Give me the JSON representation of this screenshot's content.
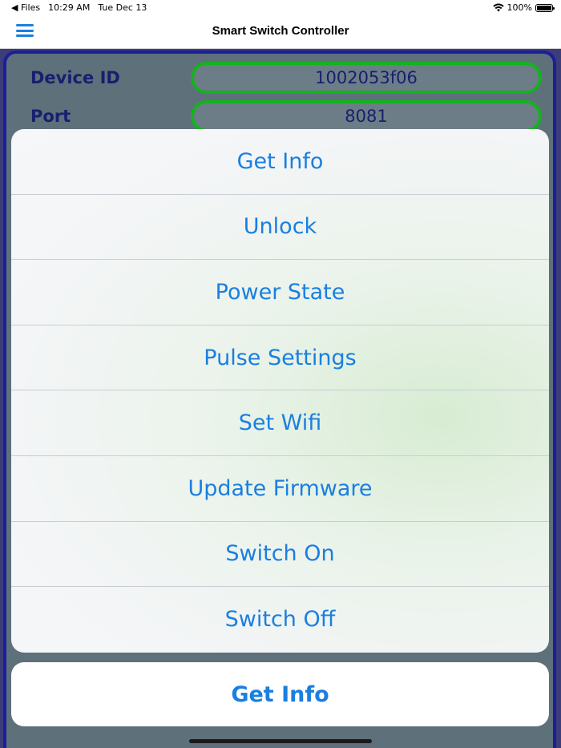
{
  "status_bar": {
    "back_app": "◀ Files",
    "time": "10:29 AM",
    "date": "Tue Dec 13",
    "battery": "100%",
    "battery_level": 1.0
  },
  "nav": {
    "title": "Smart Switch Controller",
    "menu_icon": "hamburger-menu-icon"
  },
  "form": {
    "device_id_label": "Device ID",
    "device_id_value": "1002053f06",
    "port_label": "Port",
    "port_value": "8081"
  },
  "action_sheet": {
    "items": [
      {
        "label": "Get Info"
      },
      {
        "label": "Unlock"
      },
      {
        "label": "Power State"
      },
      {
        "label": "Pulse Settings"
      },
      {
        "label": "Set Wifi"
      },
      {
        "label": "Update Firmware"
      },
      {
        "label": "Switch On"
      },
      {
        "label": "Switch Off"
      }
    ],
    "cancel_label": "Get Info"
  },
  "colors": {
    "accent": "#1a7fe0",
    "panel_border": "#1b1f9a",
    "pill_border": "#14b31e"
  }
}
